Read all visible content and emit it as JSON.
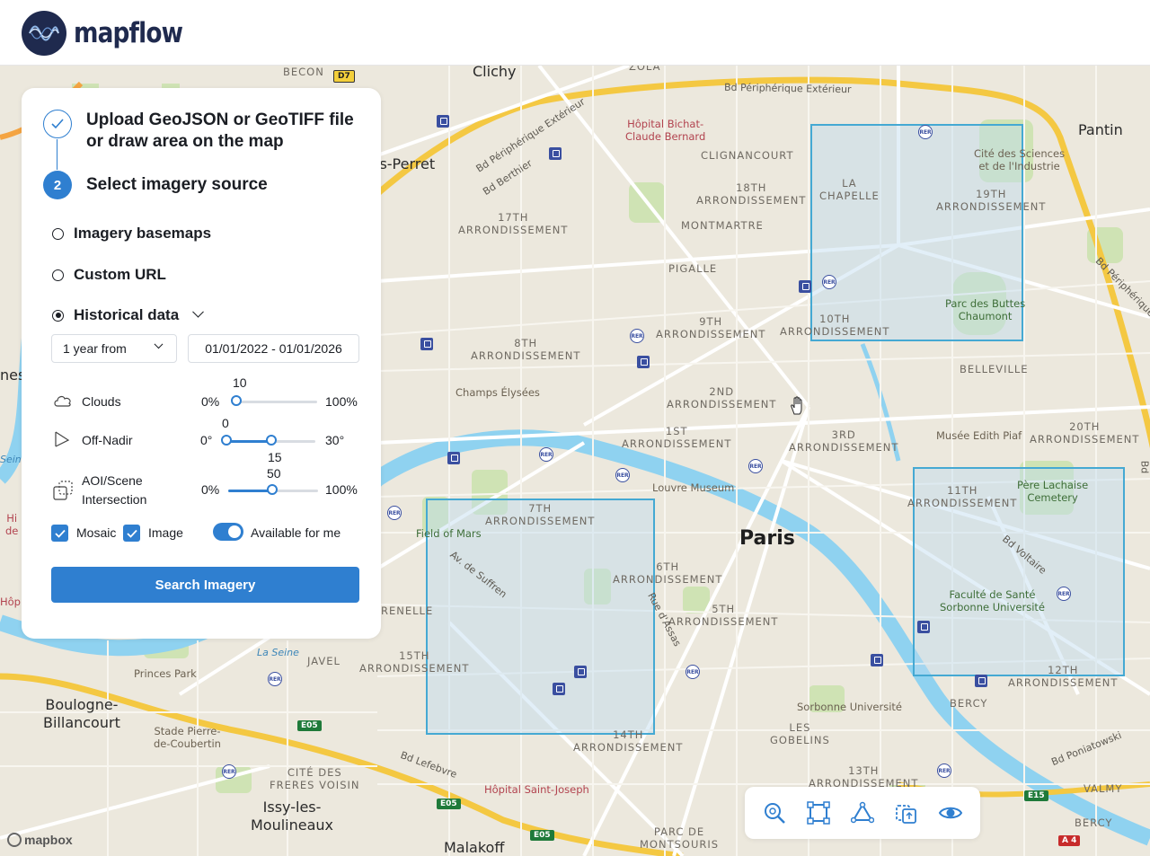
{
  "header": {
    "logo_text": "mapflow"
  },
  "panel": {
    "step1_title": "Upload GeoJSON or GeoTIFF file or draw area on the map",
    "step2_number": "2",
    "step2_title": "Select imagery source",
    "sources": [
      {
        "label": "Imagery basemaps",
        "selected": false
      },
      {
        "label": "Custom URL",
        "selected": false
      },
      {
        "label": "Historical data",
        "selected": true
      }
    ],
    "period_select": "1 year from",
    "date_range": "01/01/2022 - 01/01/2026",
    "filters": {
      "clouds": {
        "label": "Clouds",
        "min": "0%",
        "max": "100%",
        "value": "10",
        "level": 10
      },
      "off_nadir": {
        "label": "Off-Nadir",
        "min": "0°",
        "max": "30°",
        "low": "0",
        "high": "15",
        "low_level": 0,
        "high_level": 15
      },
      "aoi": {
        "label": "AOI/Scene Intersection",
        "min": "0%",
        "max": "100%",
        "value": "50",
        "level": 50
      }
    },
    "checkboxes": {
      "mosaic": "Mosaic",
      "image": "Image"
    },
    "toggle_label": "Available for me",
    "search_button": "Search Imagery"
  },
  "map": {
    "labels": {
      "clichy": "Clichy",
      "pantin": "Pantin",
      "perret": "is-Perret",
      "nes": "nes",
      "paris": "Paris",
      "boulogne": "Boulogne-\nBillancourt",
      "issy": "Issy-les-\nMoulineaux",
      "malakoff": "Malakoff",
      "arr17": "17TH\nARRONDISSEMENT",
      "arr18": "18TH\nARRONDISSEMENT",
      "arr19": "19TH\nARRONDISSEMENT",
      "arr9": "9TH\nARRONDISSEMENT",
      "arr8": "8TH\nARRONDISSEMENT",
      "arr10": "10TH\nARRONDISSEMENT",
      "arr2": "2ND\nARRONDISSEMENT",
      "arr1": "1ST\nARRONDISSEMENT",
      "arr3": "3RD\nARRONDISSEMENT",
      "arr20": "20TH\nARRONDISSEMENT",
      "arr11": "11TH\nARRONDISSEMENT",
      "arr7": "7TH\nARRONDISSEMENT",
      "arr6": "6TH\nARRONDISSEMENT",
      "arr5": "5TH\nARRONDISSEMENT",
      "arr15": "15TH\nARRONDISSEMENT",
      "arr14": "14TH\nARRONDISSEMENT",
      "arr13": "13TH\nARRONDISSEMENT",
      "arr12": "12TH\nARRONDISSEMENT",
      "clignancourt": "CLIGNANCOURT",
      "montmartre": "MONTMARTRE",
      "pigalle": "PIGALLE",
      "chapelle": "LA\nCHAPELLE",
      "belleville": "BELLEVILLE",
      "bercy": "BERCY",
      "gobelins": "LES\nGOBELINS",
      "javel": "JAVEL",
      "citedes": "CITÉ DES\nFRERES VOISIN",
      "parcmont": "PARC DE\nMONTSOURIS",
      "valmy": "VALMY",
      "bercy2": "BERCY",
      "becon": "BECON",
      "renelle": "RENELLE",
      "champs": "Champs Élysées",
      "louvre": "Louvre Museum",
      "edith": "Musée Edith Piaf",
      "pere": "Père Lachaise\nCemetery",
      "faculte": "Faculté de Santé\nSorbonne Université",
      "sorbonne": "Sorbonne Université",
      "field": "Field of Mars",
      "buttes": "Parc des Buttes\nChaumont",
      "cite": "Cité des Sciences\net de l'Industrie",
      "bichat": "Hôpital Bichat-\nClaude Bernard",
      "stjoseph": "Hôpital Saint-Joseph",
      "princes": "Princes Park",
      "stade": "Stade Pierre-\nde-Coubertin",
      "bd_peri_ext": "Bd Périphérique Extérieur",
      "bd_peri": "Bd Périphérique Extérieur",
      "bd_berthier": "Bd Berthier",
      "bd_peri_right": "Bd Périphérique",
      "av_suffren": "Av. de Suffren",
      "rue_assas": "Rue d'Assas",
      "bd_voltaire": "Bd Voltaire",
      "bd_lefebvre": "Bd Lefebvre",
      "bd_poniatowski": "Bd Poniatowski",
      "la_seine": "La Seine",
      "hi_de": "Hi\nde",
      "hopi": "Hôpi",
      "bd_right": "Bd",
      "zola": "ZOLA",
      "seine_left": "Seine"
    },
    "shields": {
      "d7": "D7",
      "e05a": "E05",
      "e05b": "E05",
      "e05c": "E05",
      "e15": "E15",
      "a4": "A 4"
    },
    "attribution": "mapbox"
  },
  "colors": {
    "accent": "#2f7fd0",
    "aoi_border": "#45a9d3",
    "brand": "#1f2a4e"
  },
  "toolbar": {
    "icons": [
      "zoom-search-icon",
      "draw-rectangle-icon",
      "draw-polygon-icon",
      "upload-area-icon",
      "visibility-icon"
    ]
  }
}
